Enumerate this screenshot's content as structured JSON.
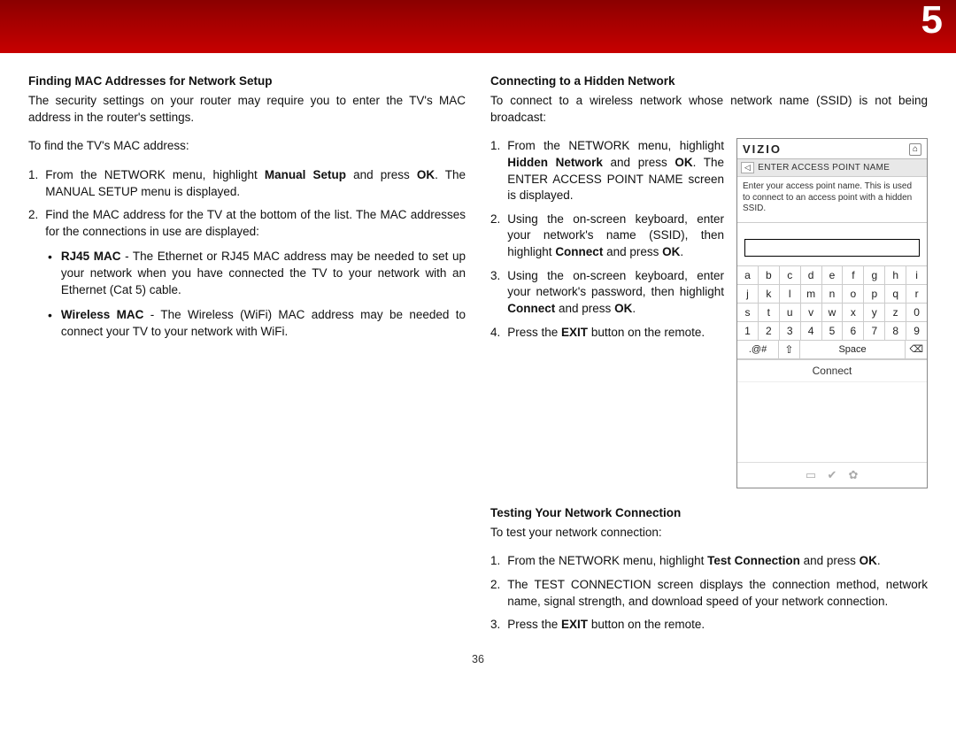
{
  "page_number_header": "5",
  "page_number_footer": "36",
  "left": {
    "heading": "Finding MAC Addresses for Network Setup",
    "intro": "The security settings on your router may require you to enter the TV's MAC address in the router's settings.",
    "lead": "To find the TV's MAC address:",
    "steps": [
      {
        "pre": "From the NETWORK menu, highlight ",
        "b": "Manual Setup",
        "mid": " and press ",
        "b2": "OK",
        "post": ". The MANUAL SETUP menu is displayed."
      },
      {
        "plain": "Find the MAC address for the TV at the bottom of the list. The MAC addresses for the connections in use are displayed:"
      }
    ],
    "bullets": [
      {
        "b": "RJ45 MAC",
        "post": " - The Ethernet or RJ45 MAC address may be needed to set up your network when you have connected the TV to your network with an Ethernet (Cat 5) cable."
      },
      {
        "b": "Wireless MAC",
        "post": " - The Wireless (WiFi) MAC address may be needed to connect your TV to your network with WiFi."
      }
    ]
  },
  "hidden": {
    "heading": "Connecting to a Hidden Network",
    "intro": "To connect to a wireless network whose network name (SSID) is not being broadcast:",
    "steps": [
      {
        "pre": "From the NETWORK menu, highlight ",
        "b": "Hidden Network",
        "mid": " and press ",
        "b2": "OK",
        "post": ". The ENTER ACCESS POINT NAME screen is displayed."
      },
      {
        "pre": "Using the on-screen keyboard, enter your network's name (SSID), then highlight ",
        "b": "Connect",
        "mid": " and press ",
        "b2": "OK",
        "post": "."
      },
      {
        "pre": "Using the on-screen keyboard, enter your network's password, then highlight ",
        "b": "Connect",
        "mid": " and press ",
        "b2": "OK",
        "post": "."
      },
      {
        "pre": "Press the ",
        "b": "EXIT",
        "post": " button on the remote."
      }
    ]
  },
  "test": {
    "heading": "Testing Your Network Connection",
    "lead": "To test your network connection:",
    "steps": [
      {
        "pre": "From the NETWORK menu, highlight ",
        "b": "Test Connection",
        "mid": " and press ",
        "b2": "OK",
        "post": "."
      },
      {
        "plain": "The TEST CONNECTION screen displays the connection method, network name, signal strength, and download speed of your network connection."
      },
      {
        "pre": "Press the ",
        "b": "EXIT",
        "post": " button on the remote."
      }
    ]
  },
  "panel": {
    "brand": "VIZIO",
    "crumb": "ENTER ACCESS POINT NAME",
    "help": "Enter your access point name.  This is used to connect to an access point with a hidden SSID.",
    "rows": [
      [
        "a",
        "b",
        "c",
        "d",
        "e",
        "f",
        "g",
        "h",
        "i"
      ],
      [
        "j",
        "k",
        "l",
        "m",
        "n",
        "o",
        "p",
        "q",
        "r"
      ],
      [
        "s",
        "t",
        "u",
        "v",
        "w",
        "x",
        "y",
        "z",
        "0"
      ],
      [
        "1",
        "2",
        "3",
        "4",
        "5",
        "6",
        "7",
        "8",
        "9"
      ]
    ],
    "sym_left": ".@#",
    "shift": "⇧",
    "space": "Space",
    "del": "⌫",
    "connect": "Connect",
    "foot": [
      "▭",
      "✔",
      "✿"
    ]
  }
}
